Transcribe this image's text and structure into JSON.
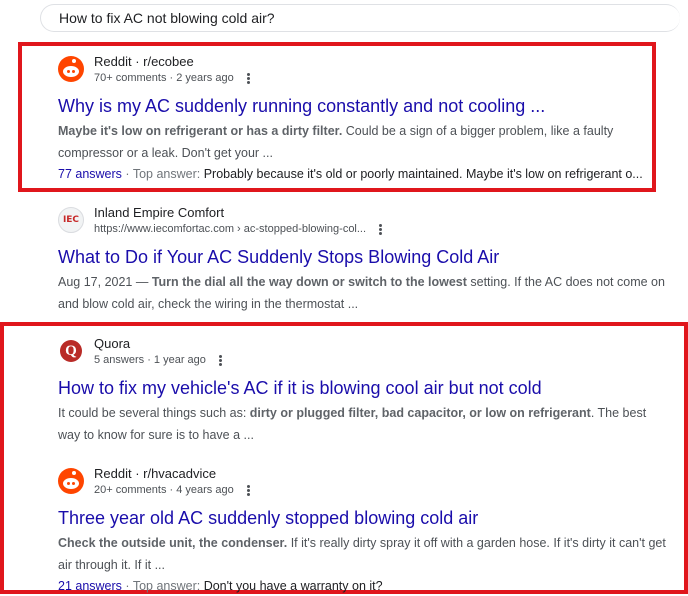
{
  "search": {
    "query": "How to fix AC not blowing cold air?"
  },
  "results": [
    {
      "site": "Reddit · r/ecobee",
      "meta": "70+ comments · 2 years ago",
      "title": "Why is my AC suddenly running constantly and not cooling ...",
      "snippet_bold": "Maybe it's low on refrigerant or has a dirty filter.",
      "snippet_rest": " Could be a sign of a bigger problem, like a faulty compressor or a leak. Don't get your ...",
      "answers": "77 answers",
      "top_answer_label": " · Top answer: ",
      "top_answer": "Probably because it's old or poorly maintained. Maybe it's low on refrigerant o..."
    },
    {
      "site": "Inland Empire Comfort",
      "meta": "https://www.iecomfortac.com › ac-stopped-blowing-col...",
      "title": "What to Do if Your AC Suddenly Stops Blowing Cold Air",
      "snippet_date": "Aug 17, 2021 — ",
      "snippet_bold": "Turn the dial all the way down or switch to the lowest",
      "snippet_rest": " setting. If the AC does not come on and blow cold air, check the wiring in the thermostat ...",
      "favicon_text": "IEC"
    },
    {
      "site": "Quora",
      "meta": "5 answers · 1 year ago",
      "title": "How to fix my vehicle's AC if it is blowing cool air but not cold",
      "snippet_pre": "It could be several things such as: ",
      "snippet_bold": "dirty or plugged filter, bad capacitor, or low on refrigerant",
      "snippet_rest": ". The best way to know for sure is to have a ...",
      "favicon_text": "Q"
    },
    {
      "site": "Reddit · r/hvacadvice",
      "meta": "20+ comments · 4 years ago",
      "title": "Three year old AC suddenly stopped blowing cold air",
      "snippet_bold": "Check the outside unit, the condenser.",
      "snippet_rest": " If it's really dirty spray it off with a garden hose. If it's dirty it can't get air through it. If it ...",
      "answers": "21 answers",
      "top_answer_label": " · Top answer: ",
      "top_answer": "Don't you have a warranty on it?"
    }
  ],
  "colors": {
    "highlight": "#e0161c",
    "link": "#1a0dab",
    "reddit": "#ff4500",
    "quora": "#b92b27"
  }
}
